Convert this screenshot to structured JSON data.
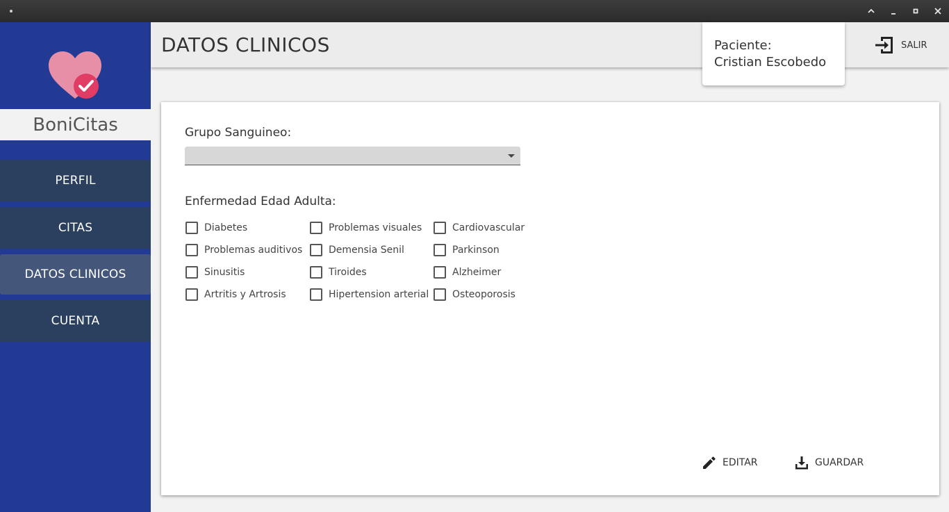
{
  "app": {
    "brand": "BoniCitas"
  },
  "header": {
    "title": "DATOS CLINICOS",
    "patient_label": "Paciente:",
    "patient_name": "Cristian Escobedo",
    "exit_label": "SALIR"
  },
  "sidebar": {
    "items": [
      {
        "label": "PERFIL"
      },
      {
        "label": "CITAS"
      },
      {
        "label": "DATOS CLINICOS",
        "active": true
      },
      {
        "label": "CUENTA"
      }
    ]
  },
  "form": {
    "blood_group_label": "Grupo Sanguineo:",
    "blood_group_value": "",
    "diseases_label": "Enfermedad Edad Adulta:",
    "diseases": [
      {
        "label": "Diabetes",
        "checked": false
      },
      {
        "label": "Problemas visuales",
        "checked": false
      },
      {
        "label": "Cardiovascular",
        "checked": false
      },
      {
        "label": "Problemas auditivos",
        "checked": false
      },
      {
        "label": "Demensia Senil",
        "checked": false
      },
      {
        "label": "Parkinson",
        "checked": false
      },
      {
        "label": "Sinusitis",
        "checked": false
      },
      {
        "label": "Tiroides",
        "checked": false
      },
      {
        "label": "Alzheimer",
        "checked": false
      },
      {
        "label": "Artritis y Artrosis",
        "checked": false
      },
      {
        "label": "Hipertension arterial",
        "checked": false
      },
      {
        "label": "Osteoporosis",
        "checked": false
      }
    ]
  },
  "actions": {
    "edit_label": "EDITAR",
    "save_label": "GUARDAR"
  },
  "colors": {
    "sidebar": "#223a94",
    "nav_item": "#2b3f5e",
    "nav_active": "#44567a",
    "logo_heart": "#e88fa8",
    "logo_badge": "#e03c64"
  }
}
